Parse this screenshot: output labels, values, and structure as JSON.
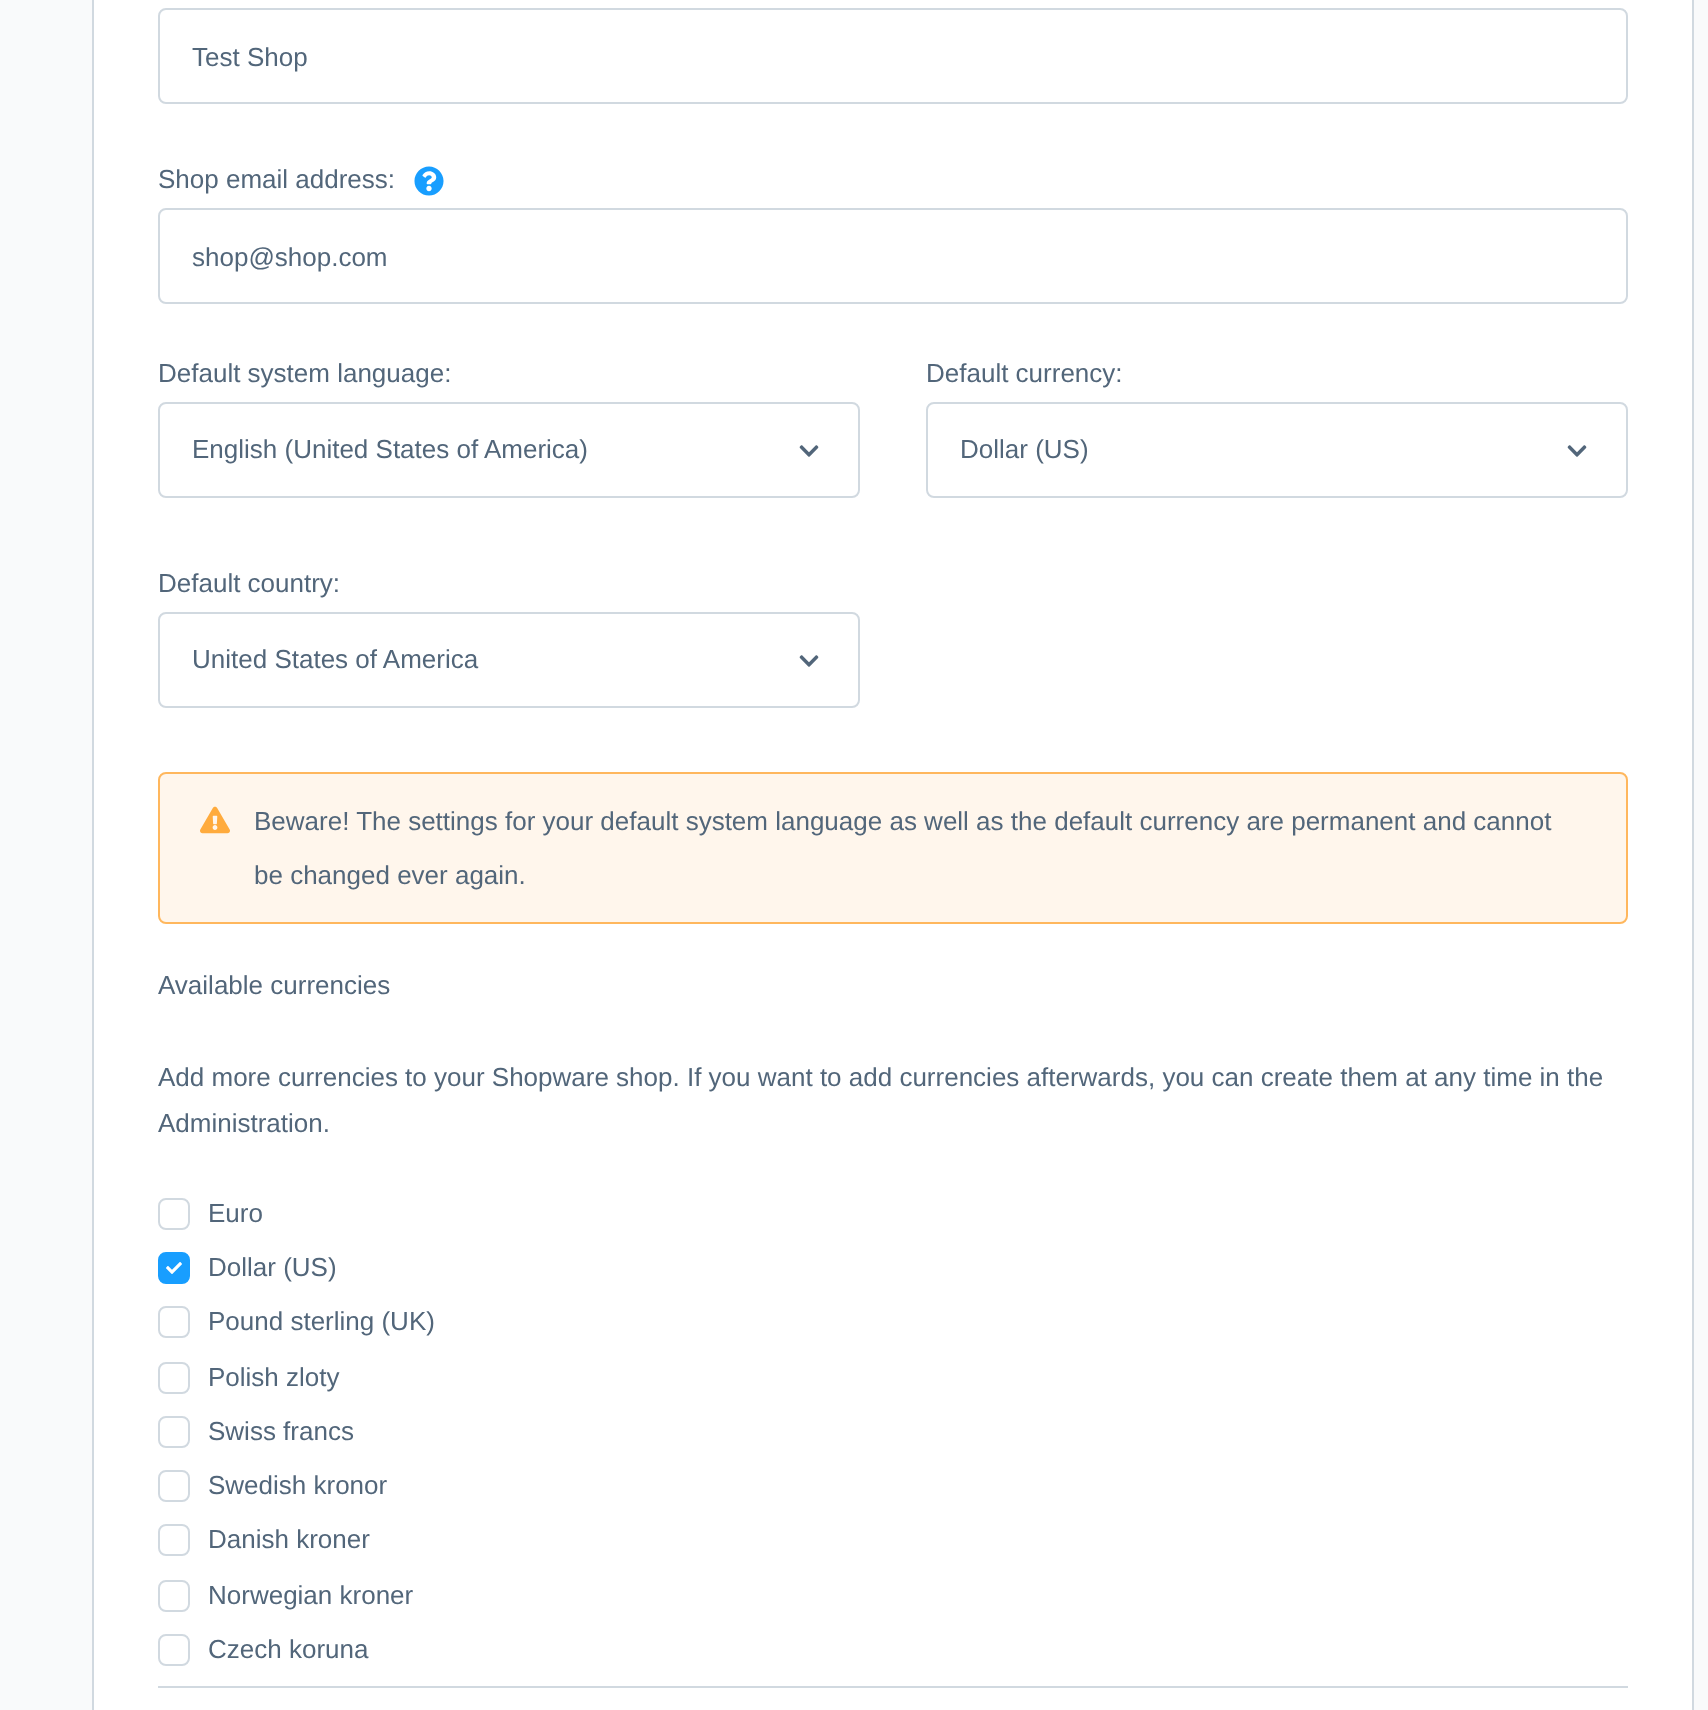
{
  "shop_name_field": {
    "value": "Test Shop"
  },
  "email_field": {
    "label": "Shop email address:",
    "help": true,
    "value": "shop@shop.com"
  },
  "selects": [
    {
      "label": "Default system language:",
      "value": "English (United States of America)"
    },
    {
      "label": "Default currency:",
      "value": "Dollar (US)"
    },
    {
      "label": "Default country:",
      "value": "United States of America"
    }
  ],
  "alert": {
    "kind": "warning",
    "text": "Beware! The settings for your default system language as well as the default currency are permanent and cannot be changed ever again."
  },
  "currencies": {
    "title": "Available currencies",
    "description": "Add more currencies to your Shopware shop. If you want to add currencies afterwards, you can create them at any time in the Administration.",
    "items": [
      {
        "label": "Euro",
        "checked": false
      },
      {
        "label": "Dollar (US)",
        "checked": true
      },
      {
        "label": "Pound sterling (UK)",
        "checked": false
      },
      {
        "label": "Polish zloty",
        "checked": false
      },
      {
        "label": "Swiss francs",
        "checked": false
      },
      {
        "label": "Swedish kronor",
        "checked": false
      },
      {
        "label": "Danish kroner",
        "checked": false
      },
      {
        "label": "Norwegian kroner",
        "checked": false
      },
      {
        "label": "Czech koruna",
        "checked": false
      }
    ]
  }
}
